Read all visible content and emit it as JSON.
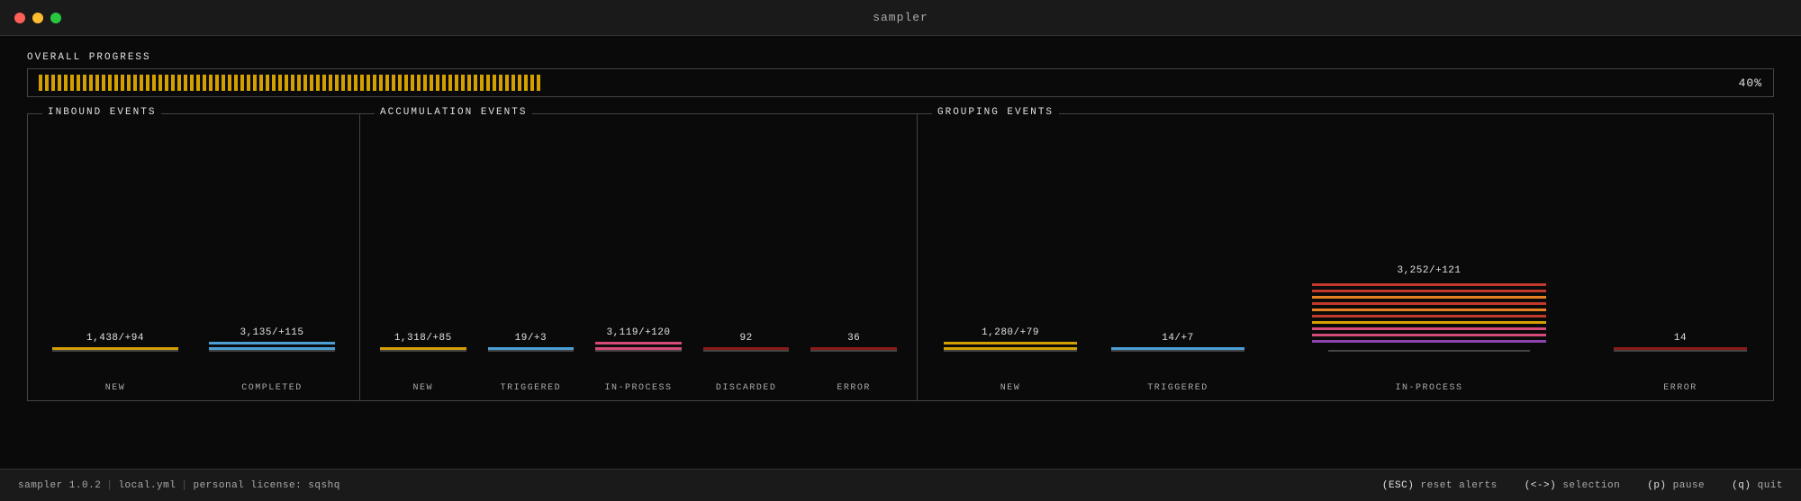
{
  "titlebar": {
    "title": "sampler"
  },
  "progress": {
    "label": "OVERALL PROGRESS",
    "percent": "40%",
    "filled_ticks": 80,
    "empty_ticks": 120
  },
  "panels": {
    "inbound": {
      "title": "INBOUND EVENTS",
      "columns": [
        {
          "value": "1,438/+94",
          "label": "NEW",
          "bars": [
            "yellow"
          ]
        },
        {
          "value": "3,135/+115",
          "label": "COMPLETED",
          "bars": [
            "blue",
            "blue"
          ]
        }
      ]
    },
    "accumulation": {
      "title": "ACCUMULATION EVENTS",
      "columns": [
        {
          "value": "1,318/+85",
          "label": "NEW",
          "bars": [
            "yellow"
          ]
        },
        {
          "value": "19/+3",
          "label": "TRIGGERED",
          "bars": [
            "blue"
          ]
        },
        {
          "value": "3,119/+120",
          "label": "IN-PROCESS",
          "bars": [
            "pink",
            "pink"
          ]
        },
        {
          "value": "92",
          "label": "DISCARDED",
          "bars": [
            "dark-red"
          ]
        },
        {
          "value": "36",
          "label": "ERROR",
          "bars": [
            "dark-red"
          ]
        }
      ]
    },
    "grouping": {
      "title": "GROUPING EVENTS",
      "columns": [
        {
          "value": "1,280/+79",
          "label": "NEW",
          "bars": [
            "yellow",
            "yellow"
          ]
        },
        {
          "value": "14/+7",
          "label": "TRIGGERED",
          "bars": [
            "blue"
          ]
        },
        {
          "value": "3,252/+121",
          "label": "IN-PROCESS",
          "stacked": true
        },
        {
          "value": "14",
          "label": "ERROR",
          "bars": [
            "dark-red"
          ]
        }
      ]
    }
  },
  "statusbar": {
    "app": "sampler 1.0.2",
    "sep1": "|",
    "config": "local.yml",
    "sep2": "|",
    "license": "personal license: sqshq",
    "esc_label": "(ESC)",
    "esc_action": "reset alerts",
    "arrow_label": "(<->)",
    "arrow_action": "selection",
    "p_label": "(p)",
    "p_action": "pause",
    "q_label": "(q)",
    "q_action": "quit"
  }
}
